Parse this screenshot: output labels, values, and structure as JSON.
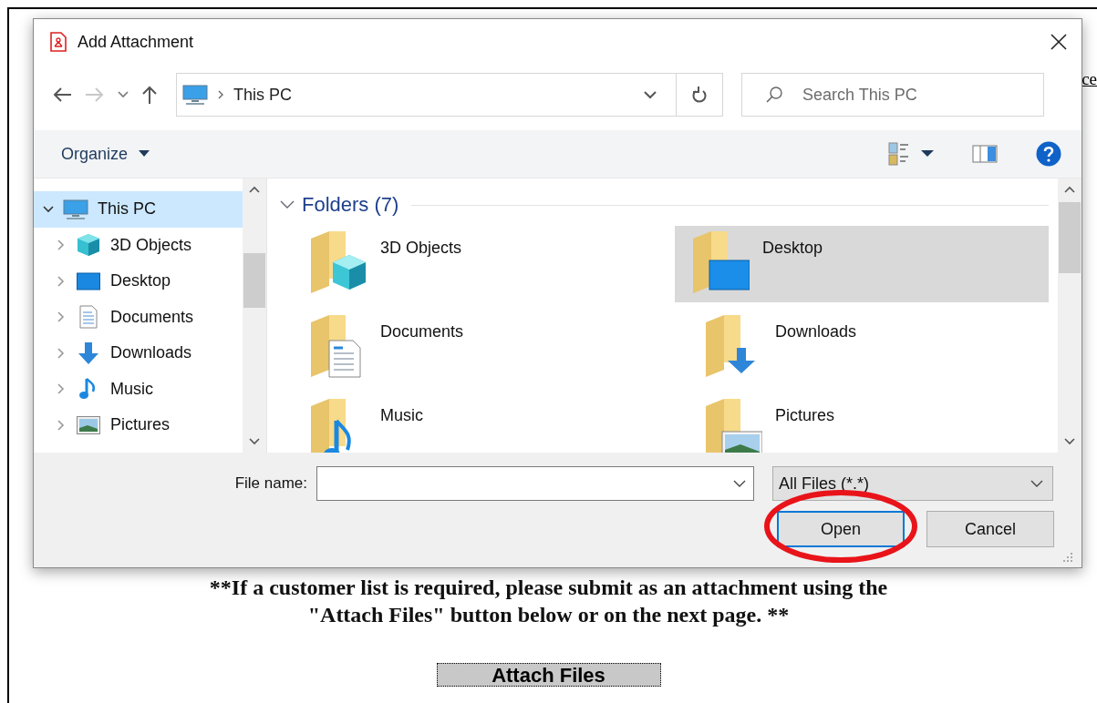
{
  "document": {
    "link_fragment": "ce",
    "notice": "**If a customer list is required, please submit as an attachment using the\n\"Attach Files\" button below or on the next page. **",
    "attach_button": "Attach Files"
  },
  "dialog": {
    "title": "Add Attachment",
    "navigation": {
      "back_disabled": false,
      "forward_disabled": true
    },
    "address": {
      "path": "This PC"
    },
    "search": {
      "placeholder": "Search This PC"
    },
    "toolbar": {
      "organize": "Organize"
    },
    "tree": [
      {
        "label": "This PC",
        "kind": "pc",
        "expanded": true,
        "selected": true,
        "children": [
          {
            "label": "3D Objects",
            "kind": "cube",
            "expanded": false,
            "selected": false
          },
          {
            "label": "Desktop",
            "kind": "desktop",
            "expanded": false,
            "selected": false
          },
          {
            "label": "Documents",
            "kind": "documents",
            "expanded": false,
            "selected": false
          },
          {
            "label": "Downloads",
            "kind": "downloads",
            "expanded": false,
            "selected": false
          },
          {
            "label": "Music",
            "kind": "music",
            "expanded": false,
            "selected": false
          },
          {
            "label": "Pictures",
            "kind": "pictures",
            "expanded": false,
            "selected": false
          }
        ]
      }
    ],
    "folders_group": {
      "label": "Folders (7)",
      "expanded": true
    },
    "folders": [
      {
        "name": "3D Objects",
        "kind": "cube",
        "selected": false
      },
      {
        "name": "Desktop",
        "kind": "desktop",
        "selected": true
      },
      {
        "name": "Documents",
        "kind": "documents",
        "selected": false
      },
      {
        "name": "Downloads",
        "kind": "downloads",
        "selected": false
      },
      {
        "name": "Music",
        "kind": "music",
        "selected": false
      },
      {
        "name": "Pictures",
        "kind": "pictures",
        "selected": false
      }
    ],
    "file_name": {
      "label": "File name:"
    },
    "file_type": {
      "value": "All Files (*.*)"
    },
    "buttons": [
      {
        "label": "Open",
        "default": true,
        "circled": true
      },
      {
        "label": "Cancel",
        "default": false,
        "circled": false
      }
    ]
  }
}
